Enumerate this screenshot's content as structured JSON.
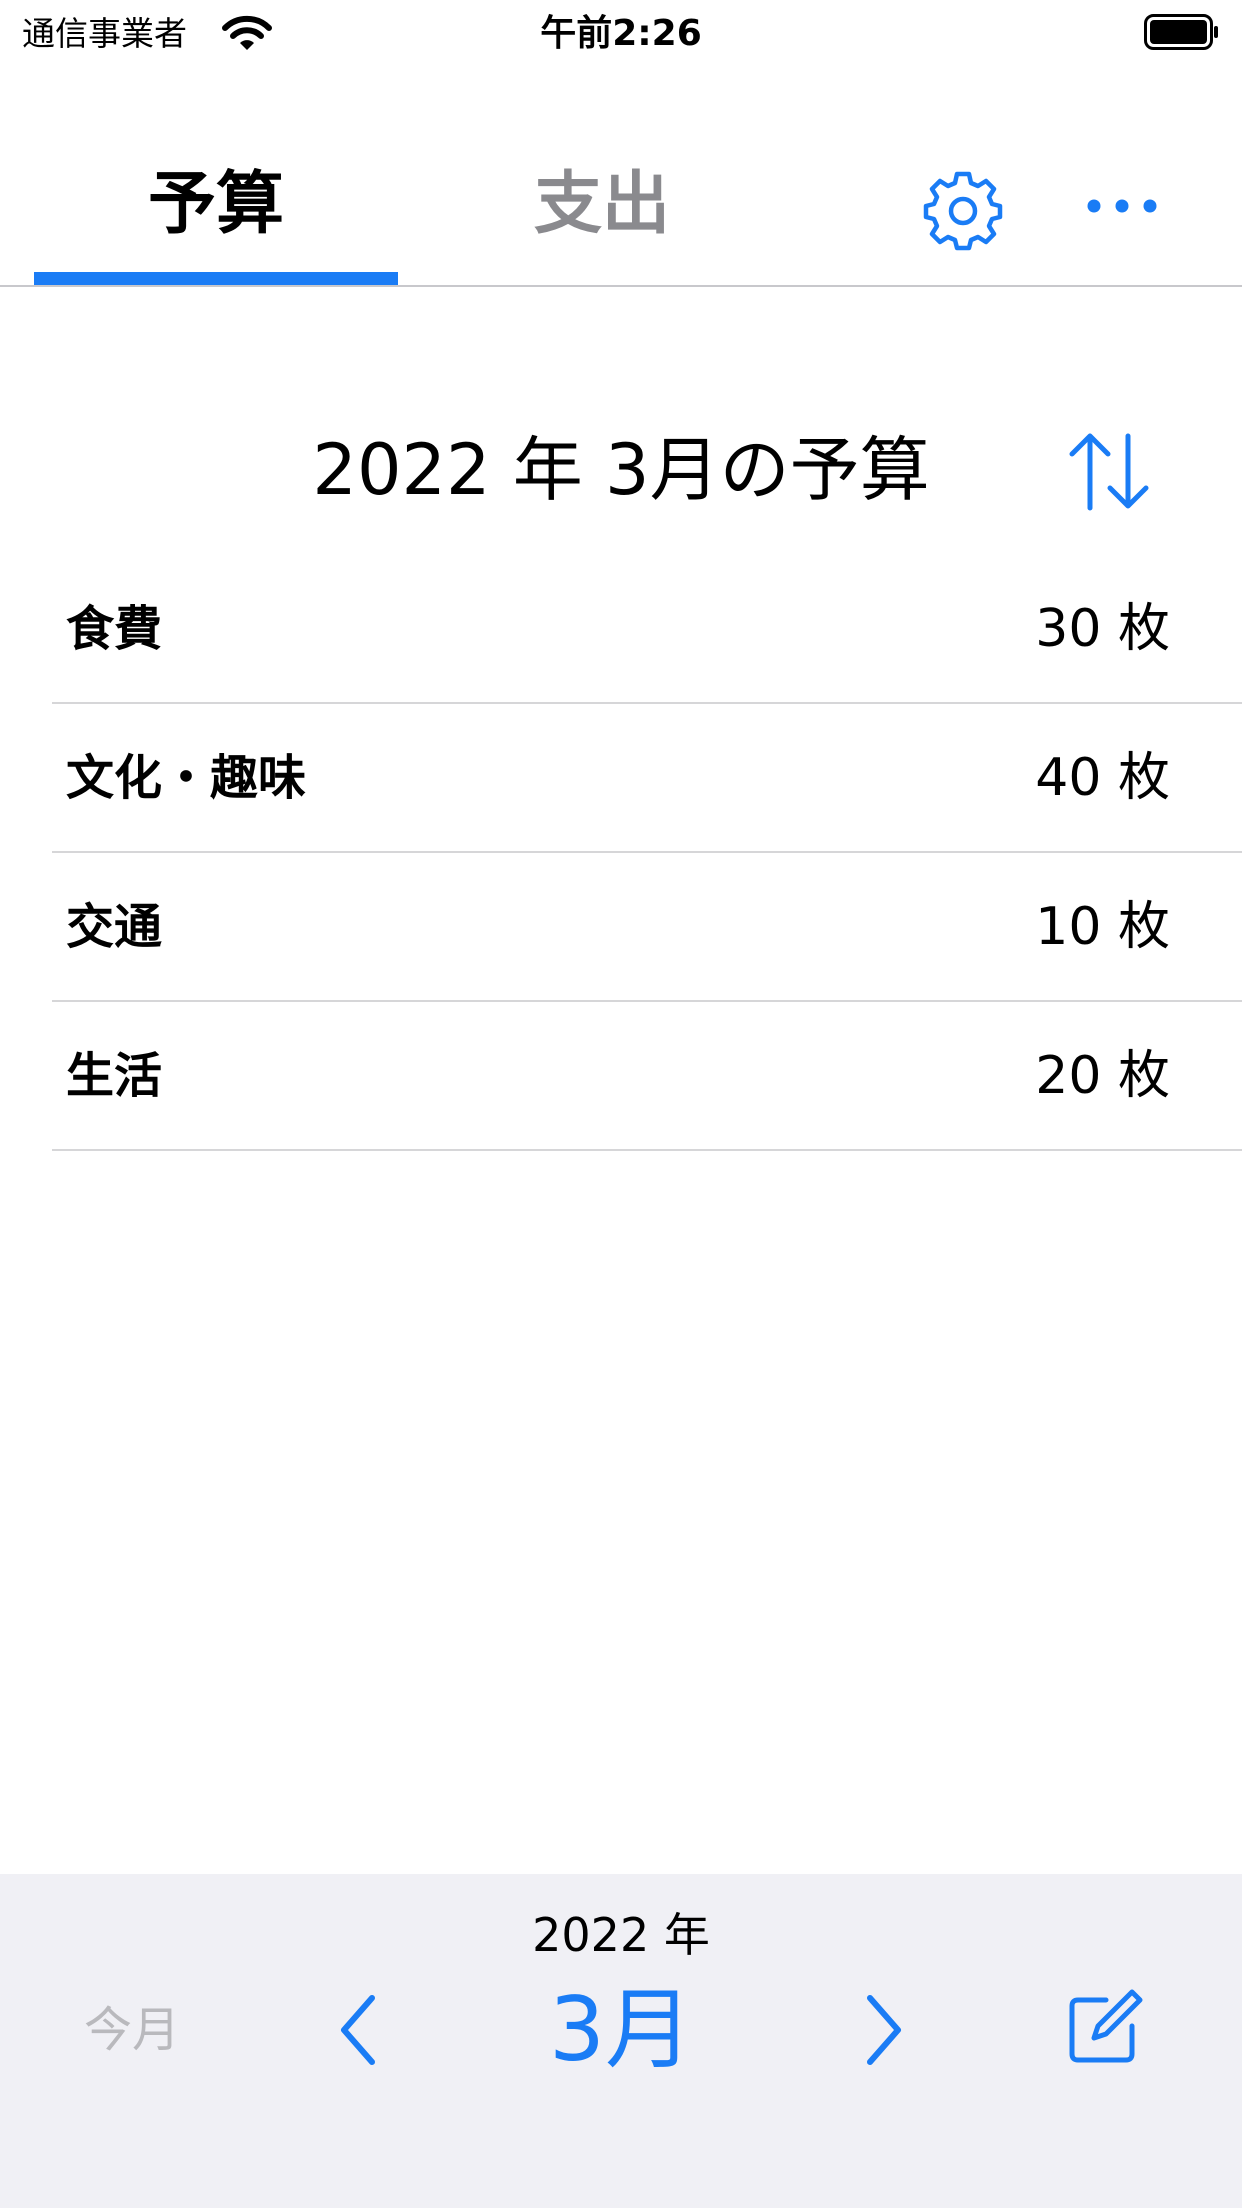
{
  "status_bar": {
    "carrier": "通信事業者",
    "time": "午前2:26"
  },
  "tabs": [
    {
      "label": "予算",
      "selected": true
    },
    {
      "label": "支出",
      "selected": false
    }
  ],
  "icons": {
    "settings": "gear-icon",
    "more": "ellipsis-icon",
    "sort": "sort-arrows-icon",
    "prev": "chevron-left-icon",
    "next": "chevron-right-icon",
    "edit": "compose-icon"
  },
  "colors": {
    "accent": "#1a7cf5",
    "bottom_bar": "#f0f0f5"
  },
  "budget": {
    "title": "2022 年 3月の予算",
    "items": [
      {
        "name": "食費",
        "value": "30 枚"
      },
      {
        "name": "文化・趣味",
        "value": "40 枚"
      },
      {
        "name": "交通",
        "value": "10 枚"
      },
      {
        "name": "生活",
        "value": "20 枚"
      }
    ]
  },
  "bottom_bar": {
    "year": "2022 年",
    "this_month_label": "今月",
    "month": "3月"
  }
}
